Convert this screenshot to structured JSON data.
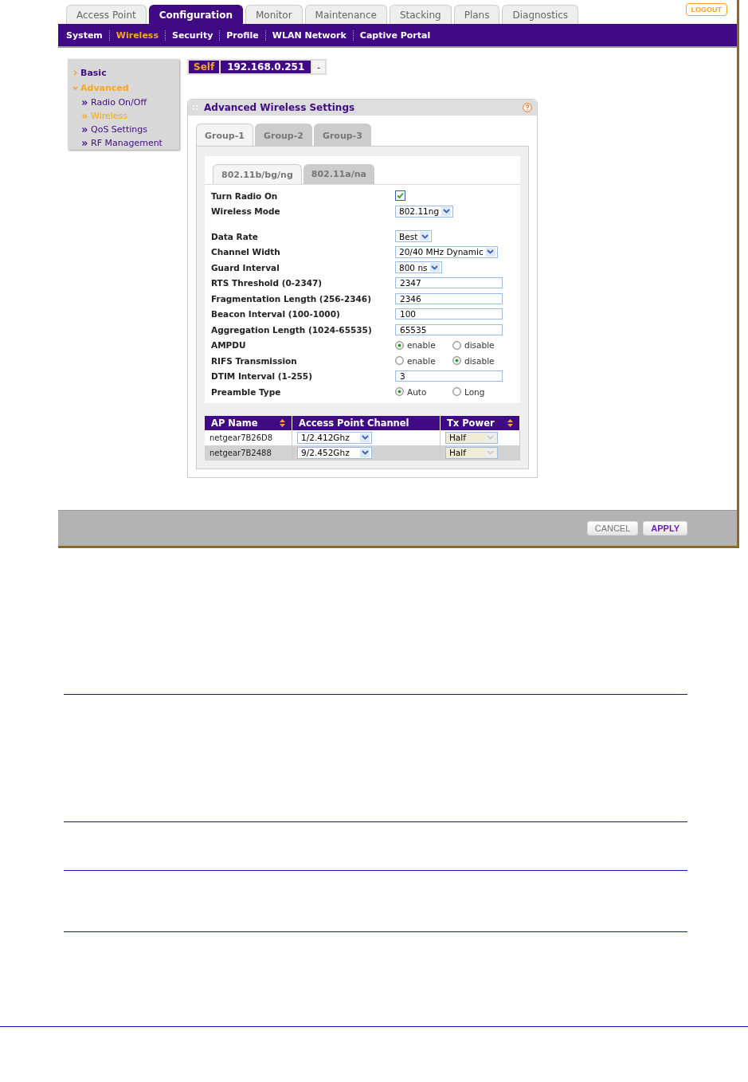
{
  "main_tabs": [
    {
      "label": "Access Point",
      "selected": false
    },
    {
      "label": "Configuration",
      "selected": true
    },
    {
      "label": "Monitor",
      "selected": false
    },
    {
      "label": "Maintenance",
      "selected": false
    },
    {
      "label": "Stacking",
      "selected": false
    },
    {
      "label": "Plans",
      "selected": false
    },
    {
      "label": "Diagnostics",
      "selected": false
    }
  ],
  "logout_button": "LOGOUT",
  "sub_nav": [
    {
      "label": "System",
      "selected": false
    },
    {
      "label": "Wireless",
      "selected": true
    },
    {
      "label": "Security",
      "selected": false
    },
    {
      "label": "Profile",
      "selected": false
    },
    {
      "label": "WLAN Network",
      "selected": false
    },
    {
      "label": "Captive Portal",
      "selected": false
    }
  ],
  "sidebar": [
    {
      "label": "Basic",
      "expanded": false,
      "selected": false
    },
    {
      "label": "Advanced",
      "expanded": true,
      "selected": true,
      "children": [
        {
          "label": "Radio On/Off",
          "selected": false
        },
        {
          "label": "Wireless",
          "selected": true
        },
        {
          "label": "QoS Settings",
          "selected": false
        },
        {
          "label": "RF Management",
          "selected": false
        }
      ]
    }
  ],
  "ap_selector": {
    "tag": "Self",
    "address": "192.168.0.251",
    "button": "-"
  },
  "panel": {
    "title": "Advanced Wireless Settings",
    "group_tabs": [
      {
        "label": "Group-1",
        "selected": true
      },
      {
        "label": "Group-2",
        "selected": false
      },
      {
        "label": "Group-3",
        "selected": false
      }
    ],
    "band_tabs": [
      {
        "label": "802.11b/bg/ng",
        "selected": true
      },
      {
        "label": "802.11a/na",
        "selected": false
      }
    ],
    "settings": [
      {
        "kind": "checkbox",
        "label": "Turn Radio On",
        "checked": true
      },
      {
        "kind": "select",
        "label": "Wireless Mode",
        "value": "802.11ng"
      },
      {
        "kind": "select",
        "label": "Data Rate",
        "value": "Best"
      },
      {
        "kind": "select",
        "label": "Channel Width",
        "value": "20/40 MHz Dynamic"
      },
      {
        "kind": "select",
        "label": "Guard Interval",
        "value": "800 ns"
      },
      {
        "kind": "input",
        "label": "RTS Threshold (0-2347)",
        "value": "2347"
      },
      {
        "kind": "input",
        "label": "Fragmentation Length (256-2346)",
        "value": "2346"
      },
      {
        "kind": "input",
        "label": "Beacon Interval (100-1000)",
        "value": "100"
      },
      {
        "kind": "input",
        "label": "Aggregation Length (1024-65535)",
        "value": "65535"
      },
      {
        "kind": "radio",
        "label": "AMPDU",
        "options": [
          {
            "label": "enable",
            "selected": true
          },
          {
            "label": "disable",
            "selected": false
          }
        ]
      },
      {
        "kind": "radio",
        "label": "RIFS Transmission",
        "options": [
          {
            "label": "enable",
            "selected": false
          },
          {
            "label": "disable",
            "selected": true
          }
        ]
      },
      {
        "kind": "input",
        "label": "DTIM Interval (1-255)",
        "value": "3"
      },
      {
        "kind": "radio",
        "label": "Preamble Type",
        "options": [
          {
            "label": "Auto",
            "selected": true
          },
          {
            "label": "Long",
            "selected": false
          }
        ]
      }
    ],
    "table": {
      "columns": [
        {
          "label": "AP Name",
          "sortable": true
        },
        {
          "label": "Access Point Channel",
          "sortable": false
        },
        {
          "label": "Tx Power",
          "sortable": true
        }
      ],
      "rows": [
        {
          "ap_name": "netgear7B26D8",
          "channel": "1/2.412Ghz",
          "tx_power": "Half",
          "tx_disabled": true
        },
        {
          "ap_name": "netgear7B2488",
          "channel": "9/2.452Ghz",
          "tx_power": "Half",
          "tx_disabled": true
        }
      ]
    }
  },
  "footer_buttons": [
    {
      "label": "CANCEL",
      "kind": "secondary"
    },
    {
      "label": "APPLY",
      "kind": "primary"
    }
  ]
}
